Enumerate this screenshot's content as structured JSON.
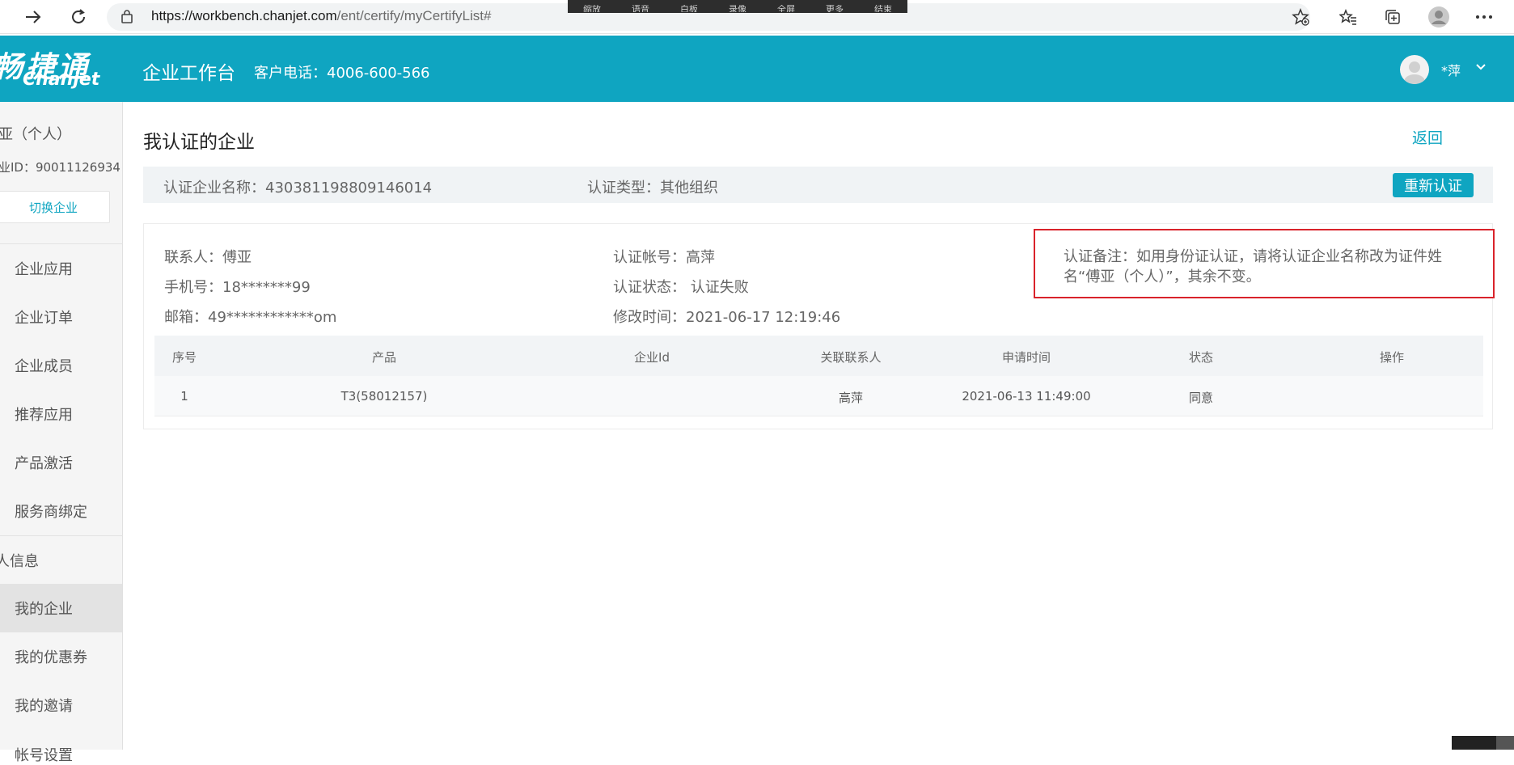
{
  "browser": {
    "url_host": "https://workbench.chanjet.com",
    "url_path": "/ent/certify/myCertifyList#",
    "overlay_toolbar": [
      "缩放",
      "语音",
      "白板",
      "录像",
      "全屏",
      "更多",
      "结束"
    ]
  },
  "header": {
    "logo_cn": "畅捷通",
    "logo_en": "Chanjet",
    "title": "企业工作台",
    "hotline": "客户电话：4006-600-566",
    "user_name": "*萍",
    "caret": "⌄"
  },
  "sidebar": {
    "org_name": "亚（个人）",
    "org_id": "业ID：90011126934",
    "switch_label": "切换企业",
    "items": [
      "企业应用",
      "企业订单",
      "企业成员",
      "推荐应用",
      "产品激活",
      "服务商绑定"
    ],
    "section_label": "人信息",
    "personal_items": [
      "我的企业",
      "我的优惠券",
      "我的邀请",
      "帐号设置"
    ]
  },
  "main": {
    "title": "我认证的企业",
    "back_label": "返回",
    "summary": {
      "name_label": "认证企业名称：",
      "name_value": "430381198809146014",
      "type_label": "认证类型：",
      "type_value": "其他组织",
      "recert_label": "重新认证"
    },
    "details": {
      "contact": "联系人：傅亚",
      "phone": "手机号：18*******99",
      "email": "邮箱：49************om",
      "account": "认证帐号：高萍",
      "status": "认证状态： 认证失败",
      "modified": "修改时间：2021-06-17 12:19:46",
      "note": "认证备注：如用身份证认证，请将认证企业名称改为证件姓名“傅亚（个人）”，其余不变。"
    },
    "table": {
      "headers": [
        "序号",
        "产品",
        "企业Id",
        "关联联系人",
        "申请时间",
        "状态",
        "操作"
      ],
      "rows": [
        [
          "1",
          "T3(58012157)",
          "",
          "高萍",
          "2021-06-13 11:49:00",
          "同意",
          ""
        ]
      ]
    }
  },
  "colors": {
    "brand": "#0fa5c1",
    "alert_border": "#d9232b"
  }
}
